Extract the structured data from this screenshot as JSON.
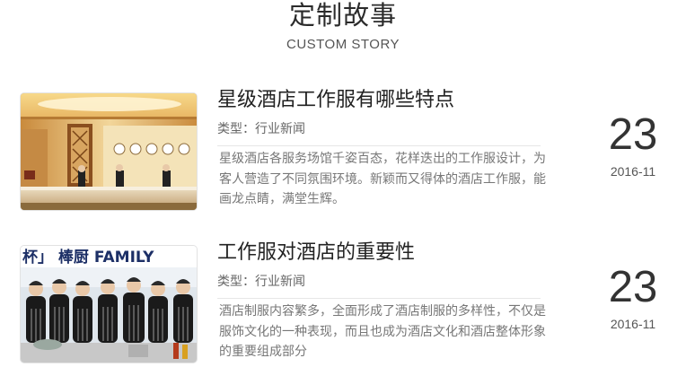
{
  "section": {
    "title": "定制故事",
    "subtitle": "CUSTOM STORY"
  },
  "stories": [
    {
      "title": "星级酒店工作服有哪些特点",
      "meta": "类型：行业新闻",
      "summary": "星级酒店各服务场馆千姿百态，花样迭出的工作服设计，为客人营造了不同氛围环境。新颖而又得体的酒店工作服，能画龙点睛，满堂生辉。",
      "day": "23",
      "month": "2016-11",
      "image": "hotel-lobby-reception"
    },
    {
      "title": "工作服对酒店的重要性",
      "meta": "类型：行业新闻",
      "summary": "酒店制服内容繁多，全面形成了酒店制服的多样性，不仅是服饰文化的一种表现，而且也成为酒店文化和酒店整体形象的重要组成部分",
      "day": "23",
      "month": "2016-11",
      "image": "kitchen-staff-group-photo",
      "image_text": "杯」 棒厨 FAMILY"
    }
  ],
  "colors": {
    "title": "#222222",
    "summary": "#777777",
    "divider": "#e6e6e6"
  }
}
